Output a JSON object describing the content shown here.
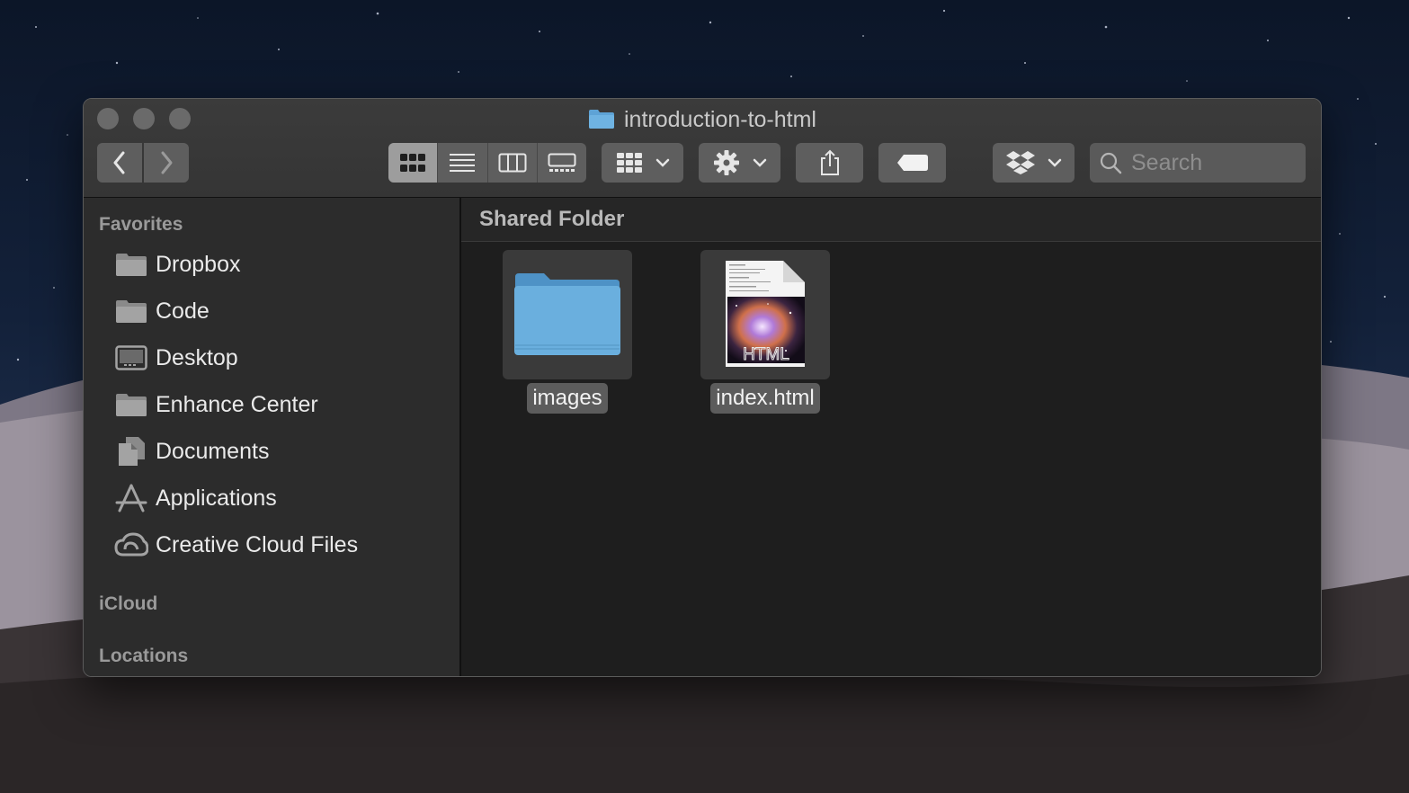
{
  "window": {
    "title": "introduction-to-html"
  },
  "toolbar": {
    "view_modes": [
      "icon-view",
      "list-view",
      "column-view",
      "gallery-view"
    ],
    "active_view": "icon-view",
    "search_placeholder": "Search"
  },
  "sidebar": {
    "favorites_heading": "Favorites",
    "items": [
      {
        "label": "Dropbox",
        "icon": "folder-icon"
      },
      {
        "label": "Code",
        "icon": "folder-icon"
      },
      {
        "label": "Desktop",
        "icon": "desktop-icon"
      },
      {
        "label": "Enhance Center",
        "icon": "folder-icon"
      },
      {
        "label": "Documents",
        "icon": "documents-icon"
      },
      {
        "label": "Applications",
        "icon": "applications-icon"
      },
      {
        "label": "Creative Cloud Files",
        "icon": "creative-cloud-icon"
      }
    ],
    "icloud_heading": "iCloud",
    "locations_heading": "Locations"
  },
  "content": {
    "header": "Shared Folder",
    "files": [
      {
        "name": "images",
        "type": "folder"
      },
      {
        "name": "index.html",
        "type": "html-document"
      }
    ]
  },
  "colors": {
    "window_bg": "#232323",
    "sidebar_bg": "#2c2c2c",
    "folder_blue": "#6aafde"
  }
}
